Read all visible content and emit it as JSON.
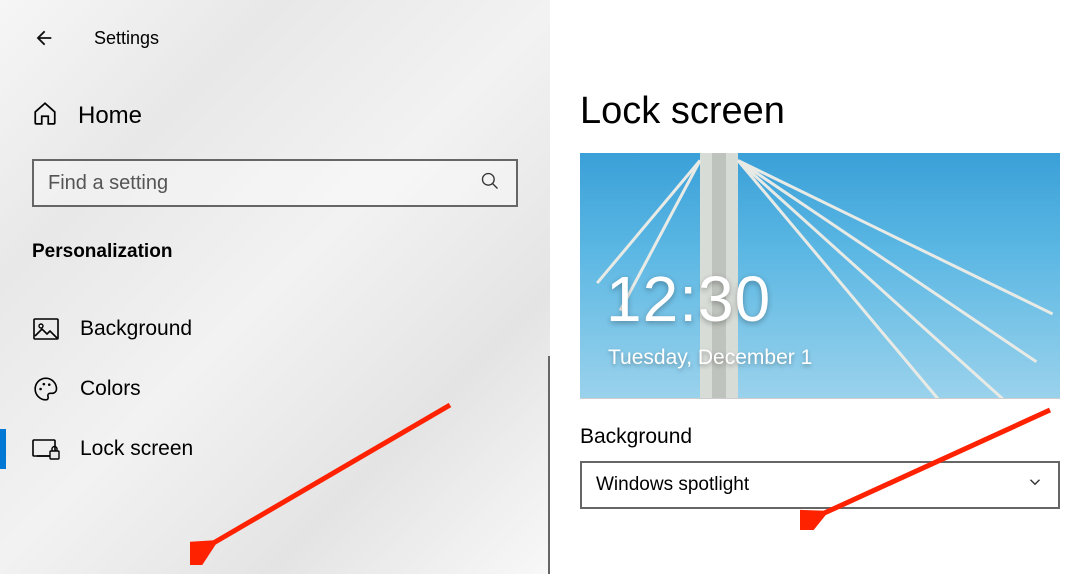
{
  "header": {
    "app_title": "Settings"
  },
  "sidebar": {
    "home_label": "Home",
    "search_placeholder": "Find a setting",
    "category": "Personalization",
    "items": [
      {
        "label": "Background",
        "selected": false
      },
      {
        "label": "Colors",
        "selected": false
      },
      {
        "label": "Lock screen",
        "selected": true
      }
    ]
  },
  "main": {
    "title": "Lock screen",
    "preview_time": "12:30",
    "preview_date": "Tuesday, December 1",
    "background_label": "Background",
    "background_value": "Windows spotlight"
  }
}
